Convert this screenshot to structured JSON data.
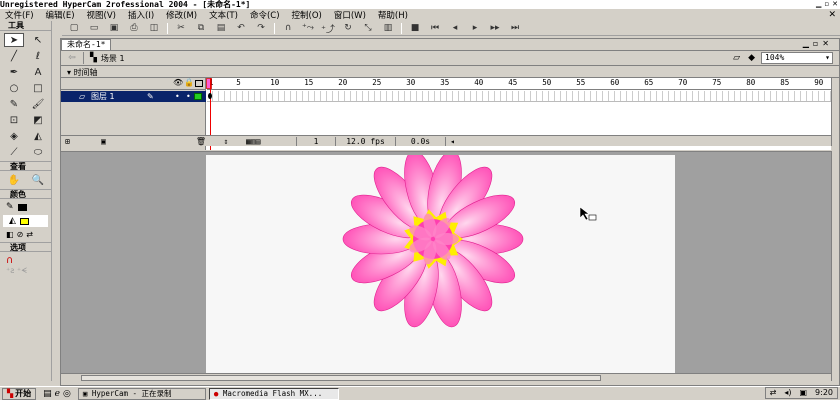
{
  "window": {
    "title": "Unregistered HyperCam 2rofessional 2004 - [未命名-1*]"
  },
  "menu": [
    "文件(F)",
    "编辑(E)",
    "视图(V)",
    "插入(I)",
    "修改(M)",
    "文本(T)",
    "命令(C)",
    "控制(O)",
    "窗口(W)",
    "帮助(H)"
  ],
  "tools_panel": {
    "title": "工具",
    "view_label": "查看",
    "colors_label": "颜色",
    "options_label": "选项",
    "fill_color": "#ffff00",
    "stroke_color": "#000000"
  },
  "document": {
    "tab": "未命名-1*",
    "scene": "场景 1",
    "zoom": "104%"
  },
  "timeline": {
    "header": "时间轴",
    "layer_name": "图层 1",
    "ruler_ticks": [
      "1",
      "5",
      "10",
      "15",
      "20",
      "25",
      "30",
      "35",
      "40",
      "45",
      "50",
      "55",
      "60",
      "65",
      "70",
      "75",
      "80",
      "85",
      "90"
    ],
    "current_frame": "1",
    "fps": "12.0 fps",
    "time": "0.0s"
  },
  "stage": {
    "flower_petal_color": "#ff3fb0",
    "flower_center_color": "#ffee00"
  },
  "taskbar": {
    "start": "开始",
    "tasks": [
      "HyperCam - 正在录制",
      "Macromedia Flash MX..."
    ],
    "clock": "9:20"
  }
}
